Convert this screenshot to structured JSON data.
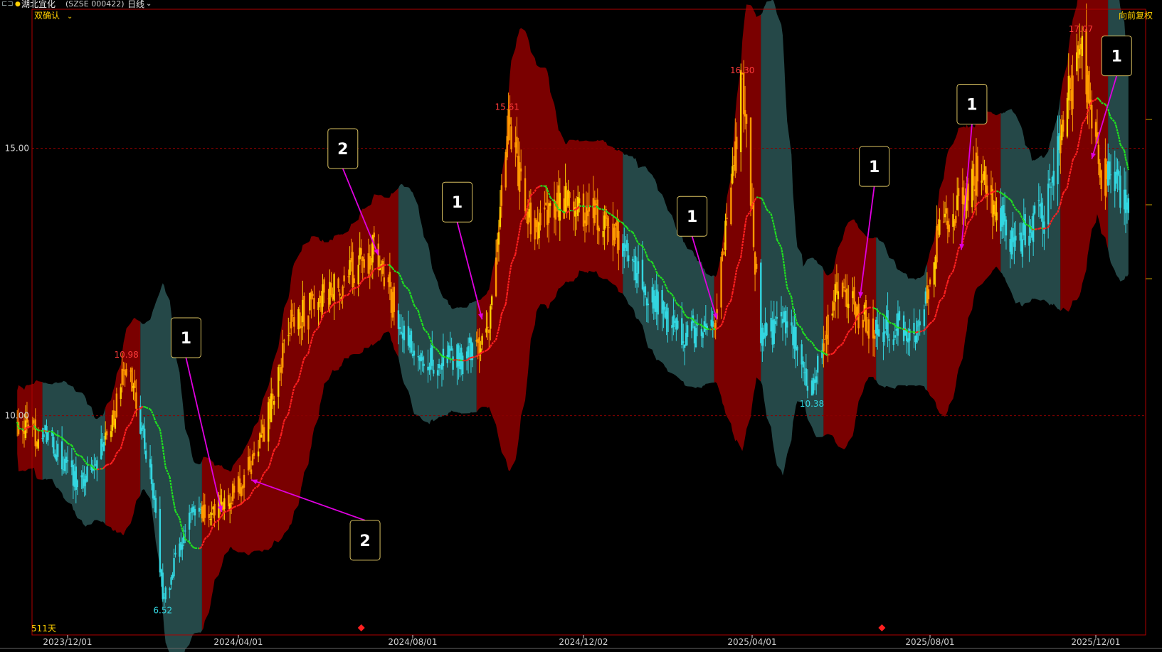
{
  "header": {
    "stock_name": "湖北宜化",
    "code": "(SZSE 000422)",
    "period": "日线",
    "indicator": "双确认",
    "adjust": "向前复权"
  },
  "colors": {
    "background": "#000000",
    "frame": "#b00000",
    "band_up": "#7a0000",
    "band_down": "#254848",
    "candle_up": "#ff9900",
    "candle_up_strong": "#ffd000",
    "candle_down": "#33d6e0",
    "line_up": "#ff2020",
    "line_down": "#20e020",
    "annotation": "#e000e0",
    "high_label": "#ff3a3a",
    "low_label": "#33d6e0"
  },
  "chart_data": {
    "type": "candlestick",
    "price_axis": {
      "ylim": [
        5.9,
        17.6
      ],
      "ticks": [
        15.0,
        10.0
      ],
      "tick_labels": [
        "15.00",
        "10.00"
      ]
    },
    "date_axis": {
      "tick_dates": [
        "2023-12-01",
        "2024-04-01",
        "2024-08-01",
        "2024-12-02",
        "2025-04-01",
        "2025-08-01",
        "2025-12-01"
      ],
      "tick_labels": [
        "2023/12/01",
        "2024/04/01",
        "2024/08/01",
        "2024/12/02",
        "2025/04/01",
        "2025/08/01",
        "2025/12/01"
      ]
    },
    "days_label": "511天",
    "price_path": [
      {
        "date": "2023-10-26",
        "price": 9.8
      },
      {
        "date": "2023-11-15",
        "price": 9.6
      },
      {
        "date": "2023-12-10",
        "price": 8.7
      },
      {
        "date": "2024-01-02",
        "price": 9.9
      },
      {
        "date": "2024-01-12",
        "price": 10.98
      },
      {
        "date": "2024-01-22",
        "price": 9.9
      },
      {
        "date": "2024-02-02",
        "price": 8.3
      },
      {
        "date": "2024-02-07",
        "price": 6.52
      },
      {
        "date": "2024-02-26",
        "price": 8.1
      },
      {
        "date": "2024-03-15",
        "price": 8.2
      },
      {
        "date": "2024-04-05",
        "price": 8.8
      },
      {
        "date": "2024-04-20",
        "price": 9.8
      },
      {
        "date": "2024-05-08",
        "price": 11.8
      },
      {
        "date": "2024-06-05",
        "price": 12.3
      },
      {
        "date": "2024-07-05",
        "price": 13.1
      },
      {
        "date": "2024-07-25",
        "price": 11.5
      },
      {
        "date": "2024-08-16",
        "price": 11.0
      },
      {
        "date": "2024-09-06",
        "price": 11.1
      },
      {
        "date": "2024-09-25",
        "price": 11.5
      },
      {
        "date": "2024-10-08",
        "price": 15.61
      },
      {
        "date": "2024-10-25",
        "price": 13.4
      },
      {
        "date": "2024-11-20",
        "price": 14.0
      },
      {
        "date": "2024-12-20",
        "price": 13.6
      },
      {
        "date": "2025-01-10",
        "price": 12.6
      },
      {
        "date": "2025-02-07",
        "price": 11.5
      },
      {
        "date": "2025-03-05",
        "price": 11.6
      },
      {
        "date": "2025-03-25",
        "price": 16.3
      },
      {
        "date": "2025-04-07",
        "price": 11.4
      },
      {
        "date": "2025-04-25",
        "price": 11.8
      },
      {
        "date": "2025-05-12",
        "price": 10.38
      },
      {
        "date": "2025-05-28",
        "price": 12.4
      },
      {
        "date": "2025-06-20",
        "price": 11.7
      },
      {
        "date": "2025-07-25",
        "price": 11.6
      },
      {
        "date": "2025-08-05",
        "price": 13.3
      },
      {
        "date": "2025-09-05",
        "price": 14.6
      },
      {
        "date": "2025-10-01",
        "price": 13.2
      },
      {
        "date": "2025-10-25",
        "price": 13.9
      },
      {
        "date": "2025-11-20",
        "price": 17.07
      },
      {
        "date": "2025-12-05",
        "price": 14.6
      },
      {
        "date": "2025-12-25",
        "price": 14.0
      }
    ],
    "regimes": [
      {
        "start": "2023-10-26",
        "end": "2023-11-12",
        "trend": "up"
      },
      {
        "start": "2023-11-12",
        "end": "2023-12-28",
        "trend": "down"
      },
      {
        "start": "2023-12-28",
        "end": "2024-01-20",
        "trend": "up"
      },
      {
        "start": "2024-01-20",
        "end": "2024-03-06",
        "trend": "down"
      },
      {
        "start": "2024-03-06",
        "end": "2024-07-20",
        "trend": "up"
      },
      {
        "start": "2024-07-20",
        "end": "2024-09-15",
        "trend": "down"
      },
      {
        "start": "2024-09-15",
        "end": "2024-12-28",
        "trend": "up"
      },
      {
        "start": "2024-12-28",
        "end": "2025-03-05",
        "trend": "down"
      },
      {
        "start": "2025-03-05",
        "end": "2025-04-05",
        "trend": "up"
      },
      {
        "start": "2025-04-05",
        "end": "2025-05-20",
        "trend": "down"
      },
      {
        "start": "2025-05-20",
        "end": "2025-06-25",
        "trend": "up"
      },
      {
        "start": "2025-06-25",
        "end": "2025-07-30",
        "trend": "down"
      },
      {
        "start": "2025-07-30",
        "end": "2025-09-20",
        "trend": "up"
      },
      {
        "start": "2025-09-20",
        "end": "2025-11-05",
        "trend": "down"
      },
      {
        "start": "2025-11-05",
        "end": "2025-12-10",
        "trend": "up"
      },
      {
        "start": "2025-12-10",
        "end": "2025-12-25",
        "trend": "down"
      }
    ],
    "extremes": [
      {
        "date": "2024-01-12",
        "price": 10.98,
        "label": "10.98",
        "kind": "high"
      },
      {
        "date": "2024-02-07",
        "price": 6.52,
        "label": "6.52",
        "kind": "low"
      },
      {
        "date": "2024-10-08",
        "price": 15.61,
        "label": "15.61",
        "kind": "high"
      },
      {
        "date": "2025-03-25",
        "price": 16.3,
        "label": "16.30",
        "kind": "high"
      },
      {
        "date": "2025-05-12",
        "price": 10.38,
        "label": "10.38",
        "kind": "low"
      },
      {
        "date": "2025-11-20",
        "price": 17.07,
        "label": "17.07",
        "kind": "high"
      }
    ],
    "annotations": [
      {
        "label": "1",
        "target_date": "2024-03-20",
        "target_price": 8.2
      },
      {
        "label": "2",
        "target_date": "2024-04-10",
        "target_price": 8.8
      },
      {
        "label": "2",
        "target_date": "2024-07-08",
        "target_price": 13.0
      },
      {
        "label": "1",
        "target_date": "2024-09-20",
        "target_price": 11.8
      },
      {
        "label": "1",
        "target_date": "2025-03-07",
        "target_price": 11.8
      },
      {
        "label": "1",
        "target_date": "2025-06-14",
        "target_price": 12.2
      },
      {
        "label": "1",
        "target_date": "2025-08-24",
        "target_price": 13.1
      },
      {
        "label": "1",
        "target_date": "2025-11-28",
        "target_price": 14.8
      }
    ],
    "markers": [
      {
        "date": "2024-06-26",
        "shape": "diamond"
      },
      {
        "date": "2025-06-29",
        "shape": "diamond"
      }
    ]
  }
}
